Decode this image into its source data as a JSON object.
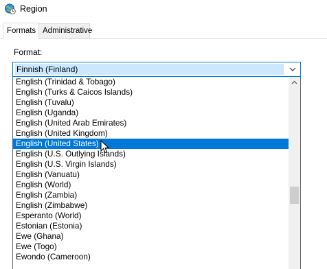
{
  "window": {
    "title": "Region",
    "icon": "globe-clock-icon"
  },
  "tabs": [
    {
      "label": "Formats",
      "active": true
    },
    {
      "label": "Administrative",
      "active": false
    }
  ],
  "format": {
    "label": "Format:",
    "selected_value": "Finnish (Finland)"
  },
  "dropdown": {
    "items": [
      {
        "label": "English (Trinidad & Tobago)",
        "selected": false
      },
      {
        "label": "English (Turks & Caicos Islands)",
        "selected": false
      },
      {
        "label": "English (Tuvalu)",
        "selected": false
      },
      {
        "label": "English (Uganda)",
        "selected": false
      },
      {
        "label": "English (United Arab Emirates)",
        "selected": false
      },
      {
        "label": "English (United Kingdom)",
        "selected": false
      },
      {
        "label": "English (United States)",
        "selected": true
      },
      {
        "label": "English (U.S. Outlying Islands)",
        "selected": false
      },
      {
        "label": "English (U.S. Virgin Islands)",
        "selected": false
      },
      {
        "label": "English (Vanuatu)",
        "selected": false
      },
      {
        "label": "English (World)",
        "selected": false
      },
      {
        "label": "English (Zambia)",
        "selected": false
      },
      {
        "label": "English (Zimbabwe)",
        "selected": false
      },
      {
        "label": "Esperanto (World)",
        "selected": false
      },
      {
        "label": "Estonian (Estonia)",
        "selected": false
      },
      {
        "label": "Ewe (Ghana)",
        "selected": false
      },
      {
        "label": "Ewe (Togo)",
        "selected": false
      },
      {
        "label": "Ewondo (Cameroon)",
        "selected": false
      }
    ]
  },
  "colors": {
    "selection": "#0078d7",
    "focus_border": "#0078d7",
    "combo_highlight": "#cce8ff"
  }
}
